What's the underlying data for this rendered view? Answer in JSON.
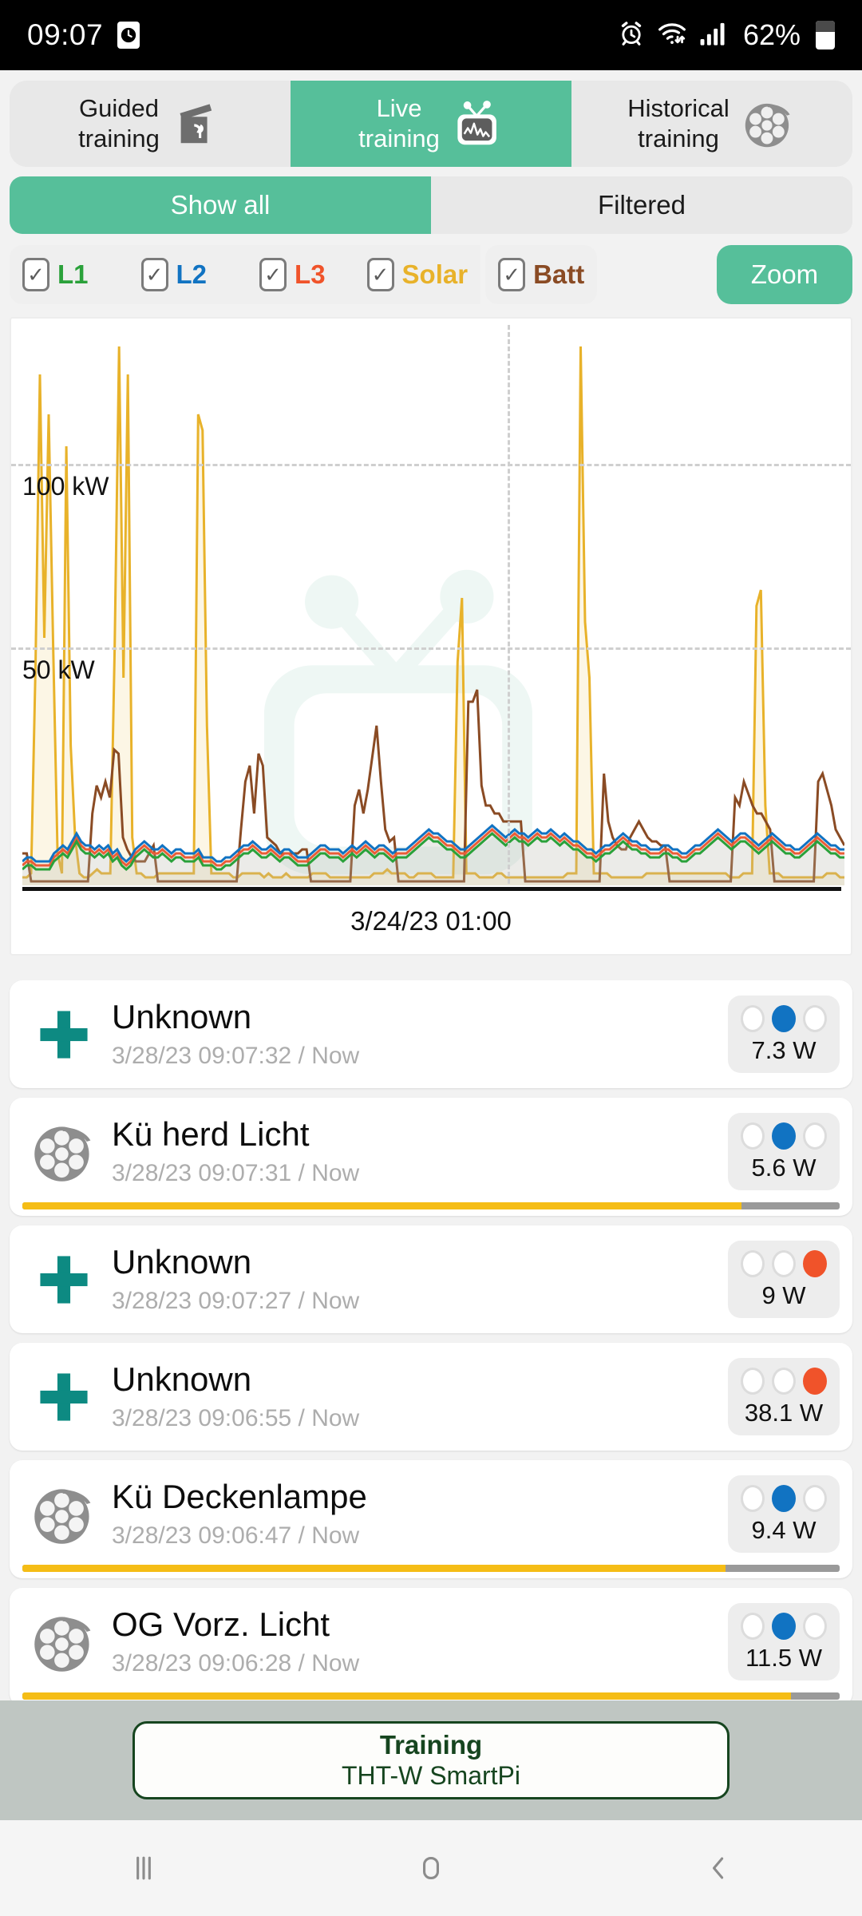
{
  "status_bar": {
    "time": "09:07",
    "battery_percent": "62%",
    "icons": [
      "clock-icon",
      "alarm-icon",
      "wifi-icon",
      "signal-icon",
      "battery-icon"
    ]
  },
  "tabs": [
    {
      "line1": "Guided",
      "line2": "training",
      "icon": "clapperboard-plant-icon",
      "active": false
    },
    {
      "line1": "Live",
      "line2": "training",
      "icon": "tv-waveform-icon",
      "active": true
    },
    {
      "line1": "Historical",
      "line2": "training",
      "icon": "film-reel-icon",
      "active": false
    }
  ],
  "segments": [
    {
      "label": "Show all",
      "active": true
    },
    {
      "label": "Filtered",
      "active": false
    }
  ],
  "filters": [
    {
      "label": "L1",
      "color": "#2aa13a",
      "checked": true
    },
    {
      "label": "L2",
      "color": "#1173c2",
      "checked": true
    },
    {
      "label": "L3",
      "color": "#f0532a",
      "checked": true
    },
    {
      "label": "Solar",
      "color": "#e8b22a",
      "checked": true
    },
    {
      "label": "Batt",
      "color": "#8a4b24",
      "checked": true
    }
  ],
  "zoom_button": {
    "label": "Zoom"
  },
  "chart_data": {
    "type": "line",
    "title": "",
    "xlabel": "3/24/23 01:00",
    "ylabel": "",
    "ylim": [
      0,
      140
    ],
    "grid": true,
    "legend": "none",
    "y_ticks": [
      {
        "value": 100,
        "label": "100 kW"
      },
      {
        "value": 50,
        "label": "50 kW"
      }
    ],
    "x_ticks": [
      {
        "label": "3/24/23 01:00"
      }
    ],
    "vertical_marker_x_fraction": 0.585,
    "series": [
      {
        "name": "Solar",
        "color": "#e8b22a",
        "filled": true,
        "values": [
          2,
          2,
          3,
          55,
          128,
          62,
          118,
          60,
          8,
          3,
          110,
          35,
          12,
          3,
          2,
          2,
          3,
          4,
          3,
          3,
          3,
          60,
          135,
          52,
          128,
          12,
          3,
          3,
          2,
          2,
          2,
          3,
          3,
          3,
          3,
          3,
          3,
          3,
          3,
          3,
          118,
          114,
          40,
          3,
          3,
          3,
          3,
          3,
          2,
          2,
          3,
          3,
          3,
          3,
          3,
          2,
          3,
          2,
          2,
          2,
          3,
          2,
          2,
          2,
          2,
          2,
          3,
          3,
          3,
          3,
          2,
          2,
          2,
          2,
          2,
          2,
          2,
          2,
          2,
          2,
          3,
          3,
          3,
          4,
          3,
          3,
          3,
          3,
          2,
          2,
          3,
          3,
          3,
          3,
          2,
          2,
          2,
          2,
          2,
          56,
          72,
          3,
          3,
          3,
          2,
          2,
          2,
          2,
          3,
          3,
          2,
          2,
          2,
          2,
          2,
          2,
          2,
          2,
          2,
          2,
          2,
          2,
          2,
          2,
          3,
          3,
          3,
          135,
          66,
          52,
          3,
          3,
          3,
          3,
          2,
          2,
          2,
          2,
          2,
          2,
          2,
          2,
          3,
          3,
          3,
          3,
          3,
          3,
          3,
          3,
          3,
          3,
          3,
          3,
          3,
          3,
          3,
          3,
          3,
          3,
          3,
          2,
          2,
          2,
          3,
          3,
          3,
          70,
          74,
          20,
          3,
          3,
          3,
          2,
          2,
          2,
          2,
          2,
          2,
          2,
          2,
          2,
          2,
          3,
          3,
          3,
          2,
          2
        ]
      },
      {
        "name": "Batt",
        "color": "#8a4b24",
        "filled": false,
        "values": [
          8,
          8,
          1,
          1,
          1,
          1,
          1,
          1,
          1,
          1,
          1,
          1,
          1,
          1,
          1,
          1,
          18,
          25,
          22,
          26,
          22,
          34,
          33,
          12,
          9,
          7,
          6,
          6,
          6,
          8,
          10,
          1,
          1,
          1,
          1,
          1,
          1,
          1,
          1,
          1,
          1,
          1,
          1,
          1,
          1,
          1,
          1,
          1,
          1,
          1,
          14,
          26,
          30,
          18,
          33,
          30,
          12,
          11,
          10,
          8,
          8,
          8,
          8,
          8,
          9,
          9,
          1,
          1,
          1,
          1,
          1,
          1,
          1,
          1,
          1,
          1,
          20,
          24,
          18,
          24,
          32,
          40,
          26,
          14,
          11,
          12,
          1,
          1,
          1,
          1,
          1,
          1,
          1,
          1,
          1,
          1,
          1,
          1,
          1,
          1,
          1,
          1,
          46,
          46,
          49,
          25,
          20,
          20,
          18,
          18,
          16,
          16,
          16,
          16,
          16,
          1,
          1,
          1,
          1,
          1,
          1,
          1,
          1,
          1,
          1,
          1,
          1,
          1,
          1,
          1,
          1,
          1,
          1,
          28,
          16,
          12,
          10,
          9,
          9,
          12,
          14,
          16,
          14,
          12,
          11,
          11,
          10,
          10,
          1,
          1,
          1,
          1,
          1,
          1,
          1,
          1,
          1,
          1,
          1,
          1,
          1,
          1,
          1,
          22,
          20,
          26,
          23,
          20,
          18,
          18,
          16,
          14,
          1,
          1,
          1,
          1,
          1,
          1,
          1,
          1,
          1,
          1,
          26,
          28,
          24,
          20,
          14,
          12,
          10
        ]
      },
      {
        "name": "L3",
        "color": "#f0532a",
        "filled": false,
        "values": [
          5,
          6,
          6,
          5,
          5,
          5,
          5,
          7,
          8,
          9,
          8,
          10,
          12,
          10,
          9,
          9,
          8,
          9,
          8,
          9,
          7,
          8,
          6,
          5,
          6,
          8,
          9,
          10,
          9,
          8,
          8,
          9,
          8,
          7,
          8,
          8,
          7,
          7,
          7,
          8,
          6,
          6,
          6,
          5,
          5,
          6,
          6,
          7,
          8,
          9,
          9,
          10,
          9,
          8,
          8,
          9,
          8,
          7,
          8,
          8,
          7,
          6,
          6,
          6,
          7,
          8,
          9,
          9,
          8,
          8,
          8,
          7,
          8,
          9,
          8,
          9,
          10,
          9,
          8,
          9,
          9,
          8,
          7,
          8,
          8,
          8,
          9,
          10,
          11,
          12,
          13,
          12,
          12,
          11,
          10,
          10,
          9,
          8,
          8,
          9,
          10,
          11,
          12,
          13,
          14,
          13,
          12,
          11,
          12,
          13,
          12,
          12,
          11,
          12,
          13,
          12,
          12,
          13,
          12,
          11,
          12,
          11,
          10,
          10,
          9,
          8,
          8,
          7,
          8,
          9,
          9,
          10,
          11,
          12,
          11,
          10,
          10,
          9,
          9,
          8,
          8,
          8,
          9,
          9,
          8,
          8,
          7,
          7,
          8,
          9,
          9,
          10,
          11,
          12,
          13,
          12,
          11,
          10,
          11,
          12,
          12,
          11,
          10,
          9,
          10,
          11,
          12,
          11,
          10,
          9,
          9,
          8,
          8,
          9,
          10,
          11,
          12,
          11,
          10,
          9,
          9,
          8,
          8
        ]
      },
      {
        "name": "L2",
        "color": "#1173c2",
        "filled": false,
        "values": [
          6,
          7,
          7,
          6,
          6,
          6,
          6,
          8,
          9,
          10,
          9,
          11,
          13,
          11,
          10,
          10,
          9,
          10,
          9,
          10,
          8,
          9,
          7,
          6,
          7,
          9,
          10,
          11,
          10,
          9,
          9,
          10,
          9,
          8,
          9,
          9,
          8,
          8,
          8,
          9,
          7,
          7,
          7,
          6,
          6,
          7,
          7,
          8,
          9,
          10,
          10,
          11,
          10,
          9,
          9,
          10,
          9,
          8,
          9,
          9,
          8,
          7,
          7,
          7,
          8,
          9,
          10,
          10,
          9,
          9,
          9,
          8,
          9,
          10,
          9,
          10,
          11,
          10,
          9,
          10,
          10,
          9,
          8,
          9,
          9,
          9,
          10,
          11,
          12,
          13,
          14,
          13,
          13,
          12,
          11,
          11,
          10,
          9,
          9,
          10,
          11,
          12,
          13,
          14,
          15,
          14,
          13,
          12,
          13,
          14,
          13,
          13,
          12,
          13,
          14,
          13,
          13,
          14,
          13,
          12,
          13,
          12,
          11,
          11,
          10,
          9,
          9,
          8,
          9,
          10,
          10,
          11,
          12,
          13,
          12,
          11,
          11,
          10,
          10,
          9,
          9,
          9,
          10,
          10,
          9,
          9,
          8,
          8,
          9,
          10,
          10,
          11,
          12,
          13,
          14,
          13,
          12,
          11,
          12,
          13,
          13,
          12,
          11,
          10,
          11,
          12,
          13,
          12,
          11,
          10,
          10,
          9,
          9,
          10,
          11,
          12,
          13,
          12,
          11,
          10,
          10,
          9,
          9
        ]
      },
      {
        "name": "L1",
        "color": "#2aa13a",
        "filled": false,
        "values": [
          4,
          5,
          5,
          4,
          4,
          4,
          4,
          6,
          7,
          8,
          7,
          9,
          11,
          9,
          8,
          8,
          7,
          8,
          7,
          8,
          6,
          7,
          5,
          4,
          5,
          7,
          8,
          9,
          8,
          7,
          7,
          8,
          7,
          6,
          7,
          7,
          6,
          6,
          6,
          7,
          5,
          5,
          5,
          4,
          4,
          5,
          5,
          6,
          7,
          8,
          8,
          9,
          8,
          7,
          7,
          8,
          7,
          6,
          7,
          7,
          6,
          5,
          5,
          5,
          6,
          7,
          8,
          8,
          7,
          7,
          7,
          6,
          7,
          8,
          7,
          8,
          9,
          8,
          7,
          8,
          8,
          7,
          6,
          7,
          7,
          7,
          8,
          9,
          10,
          11,
          12,
          11,
          11,
          10,
          9,
          9,
          8,
          7,
          7,
          8,
          9,
          10,
          11,
          12,
          13,
          12,
          11,
          10,
          11,
          12,
          11,
          11,
          10,
          11,
          12,
          11,
          11,
          12,
          11,
          10,
          11,
          10,
          9,
          9,
          8,
          7,
          7,
          6,
          7,
          8,
          8,
          9,
          10,
          11,
          10,
          9,
          9,
          8,
          8,
          7,
          7,
          7,
          8,
          8,
          7,
          7,
          6,
          6,
          7,
          8,
          8,
          9,
          10,
          11,
          12,
          11,
          10,
          9,
          10,
          11,
          11,
          10,
          9,
          8,
          9,
          10,
          11,
          10,
          9,
          8,
          8,
          7,
          7,
          8,
          9,
          10,
          11,
          10,
          9,
          8,
          8,
          7,
          7
        ]
      }
    ]
  },
  "devices": [
    {
      "icon": "plus-icon",
      "name": "Unknown",
      "time": "3/28/23 09:07:32 / Now",
      "phase": "L2",
      "value": "7.3 W",
      "progress": null
    },
    {
      "icon": "film-reel-icon",
      "name": "Kü herd Licht",
      "time": "3/28/23 09:07:31 / Now",
      "phase": "L2",
      "value": "5.6 W",
      "progress": 88
    },
    {
      "icon": "plus-icon",
      "name": "Unknown",
      "time": "3/28/23 09:07:27 / Now",
      "phase": "L3",
      "value": "9 W",
      "progress": null
    },
    {
      "icon": "plus-icon",
      "name": "Unknown",
      "time": "3/28/23 09:06:55 / Now",
      "phase": "L3",
      "value": "38.1 W",
      "progress": null
    },
    {
      "icon": "film-reel-icon",
      "name": "Kü Deckenlampe",
      "time": "3/28/23 09:06:47 / Now",
      "phase": "L2",
      "value": "9.4 W",
      "progress": 86
    },
    {
      "icon": "film-reel-icon",
      "name": "OG Vorz. Licht",
      "time": "3/28/23 09:06:28 / Now",
      "phase": "L2",
      "value": "11.5 W",
      "progress": 94
    }
  ],
  "training_bar": {
    "title": "Training",
    "subtitle": "THT-W SmartPi"
  },
  "nav_bar": {
    "recents": "recents-icon",
    "home": "home-icon",
    "back": "back-icon"
  }
}
